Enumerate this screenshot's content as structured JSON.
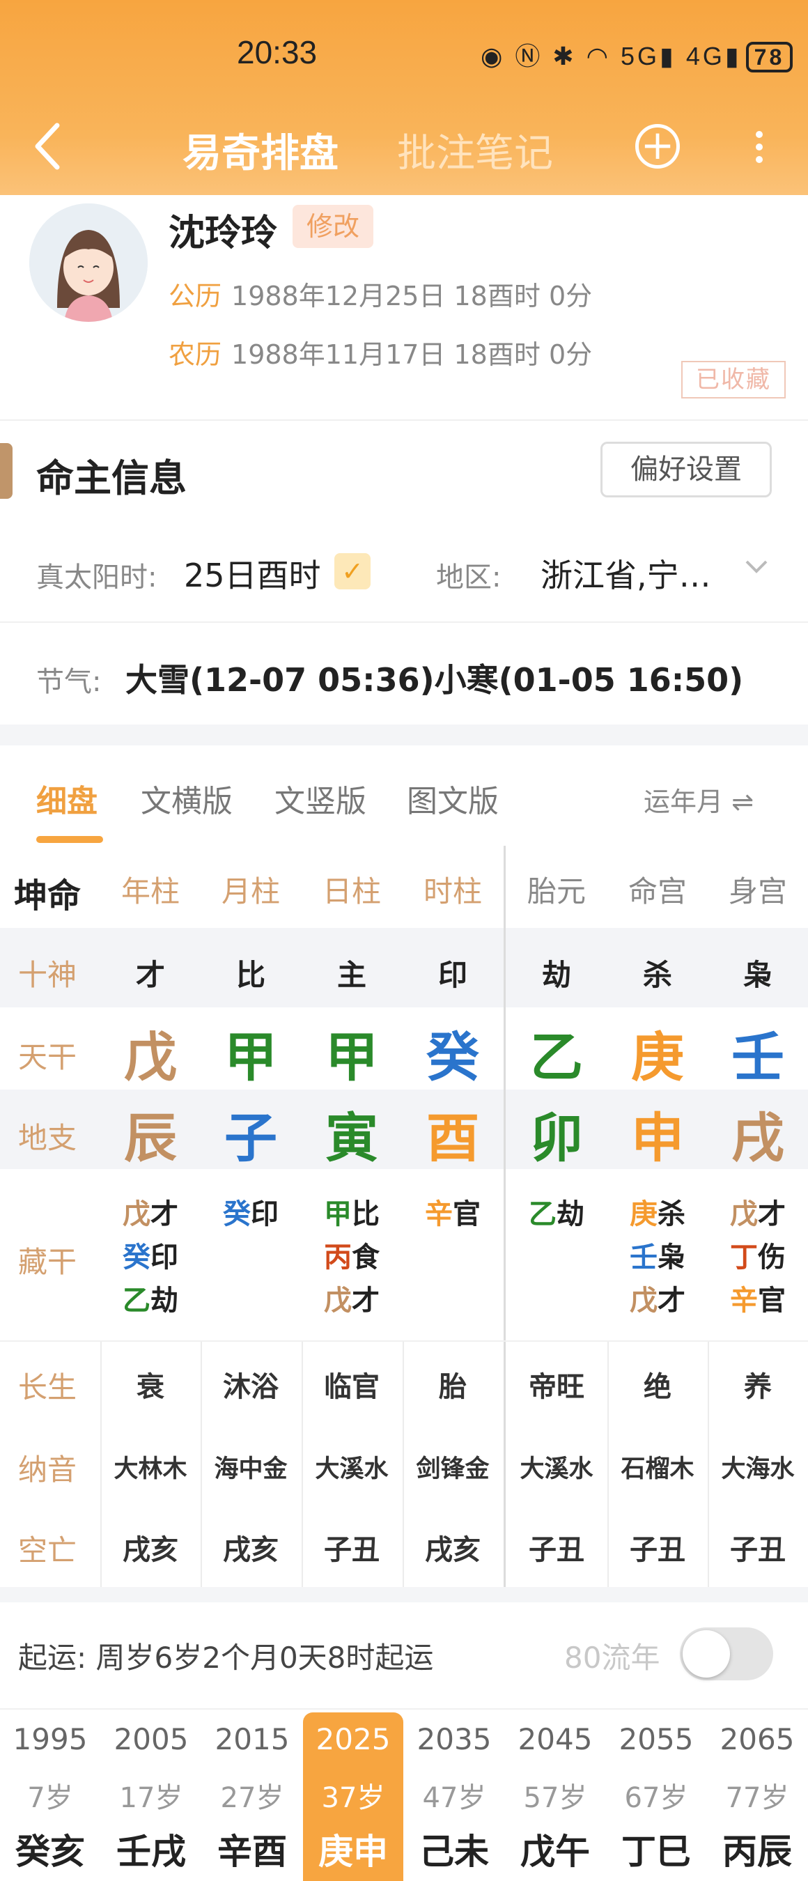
{
  "status_bar": {
    "time": "20:33",
    "icons": "◉ Ⓝ ✱ ◠ 5G▮ 4G▮",
    "battery": "78"
  },
  "nav": {
    "tab_active": "易奇排盘",
    "tab_inactive": "批注笔记",
    "plus": "+"
  },
  "profile": {
    "name": "沈玲玲",
    "edit_label": "修改",
    "solar_label": "公历",
    "solar_value": "1988年12月25日 18酉时 0分",
    "lunar_label": "农历",
    "lunar_value": "1988年11月17日 18酉时 0分",
    "seal_text": "已收藏"
  },
  "info": {
    "section_title": "命主信息",
    "pref_button": "偏好设置",
    "solar_time_label": "真太阳时:",
    "solar_time_value": "25日酉时",
    "check": "✓",
    "region_label": "地区:",
    "region_value": "浙江省,宁…",
    "jieqi_label": "节气:",
    "jieqi_value": "大雪(12-07 05:36)小寒(01-05 16:50)"
  },
  "chart_tabs": {
    "tabs": [
      "细盘",
      "文横版",
      "文竖版",
      "图文版"
    ],
    "yun_toggle": "运年月 ⇌"
  },
  "grid": {
    "corner": "坤命",
    "columns": [
      "年柱",
      "月柱",
      "日柱",
      "时柱",
      "胎元",
      "命宫",
      "身宫"
    ],
    "row_labels": {
      "shishen": "十神",
      "tiangan": "天干",
      "dizhi": "地支",
      "canggan": "藏干",
      "changsheng": "长生",
      "nayin": "纳音",
      "kongwang": "空亡"
    },
    "shishen": [
      "才",
      "比",
      "主",
      "印",
      "劫",
      "杀",
      "枭"
    ],
    "tiangan": [
      "戊",
      "甲",
      "甲",
      "癸",
      "乙",
      "庚",
      "壬"
    ],
    "dizhi": [
      "辰",
      "子",
      "寅",
      "酉",
      "卯",
      "申",
      "戌"
    ],
    "canggan": [
      [
        {
          "g": "戊",
          "s": "才"
        },
        {
          "g": "癸",
          "s": "印"
        },
        {
          "g": "乙",
          "s": "劫"
        }
      ],
      [
        {
          "g": "癸",
          "s": "印"
        }
      ],
      [
        {
          "g": "甲",
          "s": "比"
        },
        {
          "g": "丙",
          "s": "食"
        },
        {
          "g": "戊",
          "s": "才"
        }
      ],
      [
        {
          "g": "辛",
          "s": "官"
        }
      ],
      [
        {
          "g": "乙",
          "s": "劫"
        }
      ],
      [
        {
          "g": "庚",
          "s": "杀"
        },
        {
          "g": "壬",
          "s": "枭"
        },
        {
          "g": "戊",
          "s": "才"
        }
      ],
      [
        {
          "g": "戊",
          "s": "才"
        },
        {
          "g": "丁",
          "s": "伤"
        },
        {
          "g": "辛",
          "s": "官"
        }
      ]
    ],
    "changsheng": [
      "衰",
      "沐浴",
      "临官",
      "胎",
      "帝旺",
      "绝",
      "养"
    ],
    "nayin": [
      "大林木",
      "海中金",
      "大溪水",
      "剑锋金",
      "大溪水",
      "石榴木",
      "大海水"
    ],
    "kongwang": [
      "戌亥",
      "戌亥",
      "子丑",
      "戌亥",
      "子丑",
      "子丑",
      "子丑"
    ]
  },
  "qiyun": {
    "text": "起运:  周岁6岁2个月0天8时起运",
    "liunian_label": "80流年"
  },
  "dayun": [
    {
      "year": "1995",
      "age": "7岁",
      "gz": "癸亥"
    },
    {
      "year": "2005",
      "age": "17岁",
      "gz": "壬戌"
    },
    {
      "year": "2015",
      "age": "27岁",
      "gz": "辛酉"
    },
    {
      "year": "2025",
      "age": "37岁",
      "gz": "庚申"
    },
    {
      "year": "2035",
      "age": "47岁",
      "gz": "己未"
    },
    {
      "year": "2045",
      "age": "57岁",
      "gz": "戊午"
    },
    {
      "year": "2055",
      "age": "67岁",
      "gz": "丁巳"
    },
    {
      "year": "2065",
      "age": "77岁",
      "gz": "丙辰"
    }
  ],
  "dayun_selected": "2025"
}
